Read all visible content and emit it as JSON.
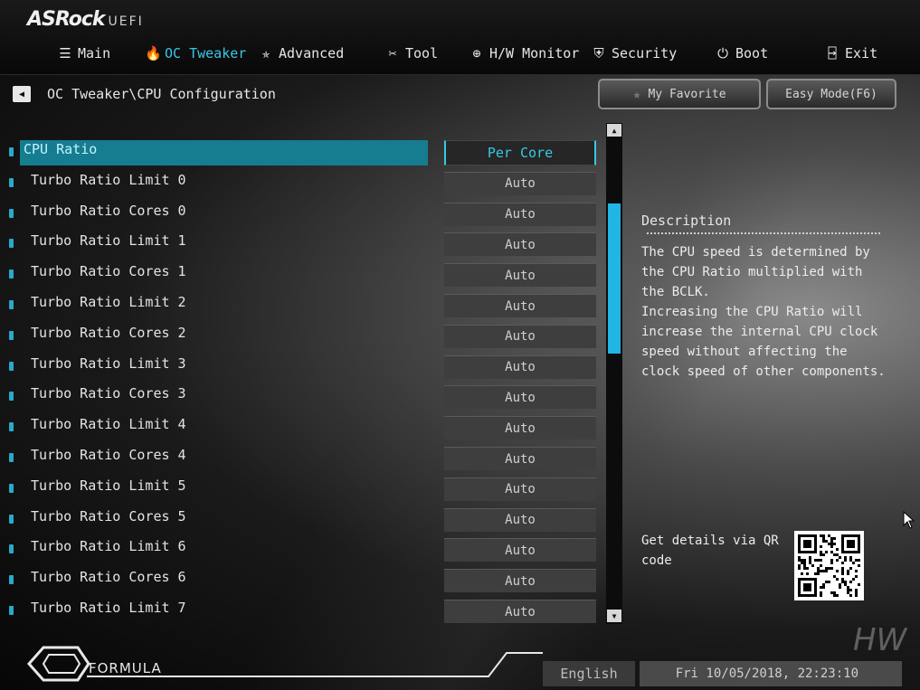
{
  "brand": {
    "name": "ASRock",
    "sub": "UEFI"
  },
  "nav": [
    {
      "label": "Main",
      "icon": "list-icon",
      "glyph": "☰",
      "active": false
    },
    {
      "label": "OC Tweaker",
      "icon": "flame-icon",
      "glyph": "🔥",
      "active": true
    },
    {
      "label": "Advanced",
      "icon": "star-icon",
      "glyph": "✯",
      "active": false
    },
    {
      "label": "Tool",
      "icon": "tools-icon",
      "glyph": "✂",
      "active": false
    },
    {
      "label": "H/W Monitor",
      "icon": "monitor-icon",
      "glyph": "⊕",
      "active": false
    },
    {
      "label": "Security",
      "icon": "shield-icon",
      "glyph": "⛨",
      "active": false
    },
    {
      "label": "Boot",
      "icon": "power-icon",
      "glyph": "⏻",
      "active": false
    },
    {
      "label": "Exit",
      "icon": "exit-icon",
      "glyph": "⍈",
      "active": false
    }
  ],
  "breadcrumb": "OC Tweaker\\CPU Configuration",
  "buttons": {
    "favorite": "My Favorite",
    "easy_mode": "Easy Mode(F6)"
  },
  "settings": [
    {
      "label": "CPU Ratio",
      "value": "Per Core",
      "selected": true
    },
    {
      "label": "Turbo Ratio Limit 0",
      "value": "Auto"
    },
    {
      "label": "Turbo Ratio Cores 0",
      "value": "Auto"
    },
    {
      "label": "Turbo Ratio Limit 1",
      "value": "Auto"
    },
    {
      "label": "Turbo Ratio Cores 1",
      "value": "Auto"
    },
    {
      "label": "Turbo Ratio Limit 2",
      "value": "Auto"
    },
    {
      "label": "Turbo Ratio Cores 2",
      "value": "Auto"
    },
    {
      "label": "Turbo Ratio Limit 3",
      "value": "Auto"
    },
    {
      "label": "Turbo Ratio Cores 3",
      "value": "Auto"
    },
    {
      "label": "Turbo Ratio Limit 4",
      "value": "Auto"
    },
    {
      "label": "Turbo Ratio Cores 4",
      "value": "Auto"
    },
    {
      "label": "Turbo Ratio Limit 5",
      "value": "Auto"
    },
    {
      "label": "Turbo Ratio Cores 5",
      "value": "Auto"
    },
    {
      "label": "Turbo Ratio Limit 6",
      "value": "Auto"
    },
    {
      "label": "Turbo Ratio Cores 6",
      "value": "Auto"
    },
    {
      "label": "Turbo Ratio Limit 7",
      "value": "Auto"
    }
  ],
  "description": {
    "title": "Description",
    "text": "The CPU speed is determined by the CPU Ratio multiplied with the BCLK.\nIncreasing the CPU Ratio will increase the internal CPU clock speed without affecting the clock speed of other components."
  },
  "qr_text": "Get details via QR code",
  "footer": {
    "formula": "FORMULA",
    "language": "English",
    "datetime": "Fri 10/05/2018, 22:23:10",
    "watermark": "HW"
  },
  "colors": {
    "accent": "#37c8e6",
    "selected_row": "#167c90",
    "scroll_thumb": "#1fb6e6"
  }
}
